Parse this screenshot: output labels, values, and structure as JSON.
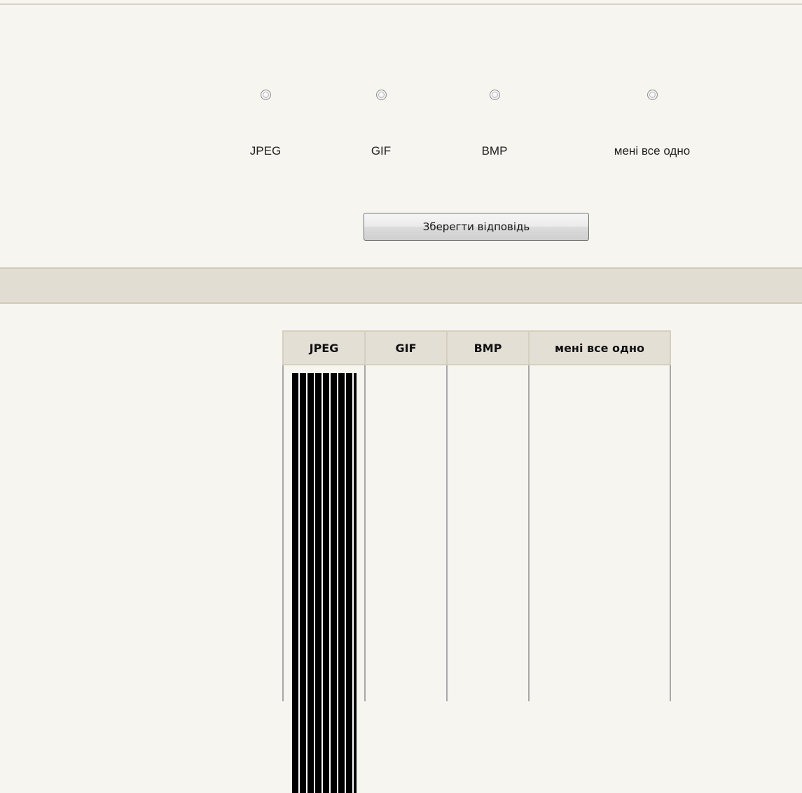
{
  "poll": {
    "options": [
      {
        "label": "JPEG"
      },
      {
        "label": "GIF"
      },
      {
        "label": "BMP"
      },
      {
        "label": "мені все одно"
      }
    ],
    "submit_label": "Зберегти відповідь"
  },
  "results": {
    "headers": [
      "JPEG",
      "GIF",
      "BMP",
      "мені все одно"
    ],
    "bar_colors": {
      "fill": "#000000",
      "stripe": "#ffffff"
    }
  }
}
